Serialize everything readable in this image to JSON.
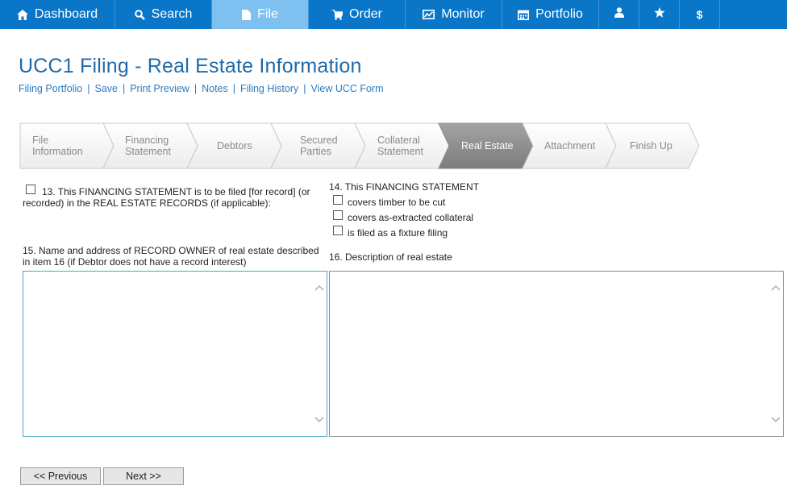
{
  "nav": {
    "items": [
      {
        "label": "Dashboard",
        "icon": "home-icon"
      },
      {
        "label": "Search",
        "icon": "search-icon"
      },
      {
        "label": "File",
        "icon": "file-icon"
      },
      {
        "label": "Order",
        "icon": "cart-icon"
      },
      {
        "label": "Monitor",
        "icon": "monitor-icon"
      },
      {
        "label": "Portfolio",
        "icon": "calendar-icon"
      },
      {
        "label": "",
        "icon": "user-icon"
      },
      {
        "label": "",
        "icon": "star-icon"
      },
      {
        "label": "$",
        "icon": "dollar-icon"
      }
    ],
    "active": "File"
  },
  "page": {
    "title": "UCC1 Filing - Real Estate Information",
    "actions": [
      "Filing Portfolio",
      "Save",
      "Print Preview",
      "Notes",
      "Filing History",
      "View UCC Form"
    ]
  },
  "wizard": {
    "steps": [
      {
        "line1": "File",
        "line2": "Information"
      },
      {
        "line1": "Financing",
        "line2": "Statement"
      },
      {
        "line1": "Debtors",
        "line2": ""
      },
      {
        "line1": "Secured",
        "line2": "Parties"
      },
      {
        "line1": "Collateral",
        "line2": "Statement"
      },
      {
        "line1": "Real Estate",
        "line2": ""
      },
      {
        "line1": "Attachment",
        "line2": ""
      },
      {
        "line1": "Finish Up",
        "line2": ""
      }
    ],
    "active_step": "Real Estate"
  },
  "form": {
    "item13": {
      "line1": "13. This FINANCING STATEMENT is to be filed [for record] (or",
      "line2": "recorded) in the REAL ESTATE RECORDS (if applicable):",
      "checked": false
    },
    "item14": {
      "heading": "14. This FINANCING STATEMENT",
      "options": [
        {
          "label": "covers timber to be cut",
          "checked": false
        },
        {
          "label": "covers as-extracted collateral",
          "checked": false
        },
        {
          "label": "is filed as a fixture filing",
          "checked": false
        }
      ]
    },
    "item15": {
      "line1": "15. Name and address of RECORD OWNER of real estate described",
      "line2": "in item 16 (if Debtor does not have a record interest)",
      "value": ""
    },
    "item16": {
      "label": "16. Description of real estate",
      "value": ""
    }
  },
  "buttons": {
    "previous": "<< Previous",
    "next": "Next >>"
  },
  "colors": {
    "nav_bg": "#0a76c8",
    "nav_active": "#7ec0ef",
    "title": "#1e6aaa",
    "link": "#2a7ac0",
    "wizard_active": "#8c8c8c"
  }
}
